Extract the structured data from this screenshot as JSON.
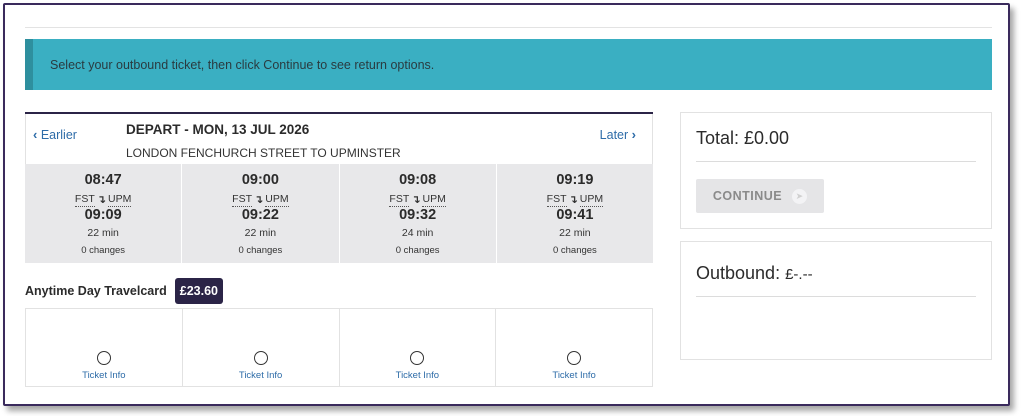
{
  "banner": {
    "text": "Select your outbound ticket, then click Continue to see return options."
  },
  "journey": {
    "earlier_label": "Earlier",
    "later_label": "Later",
    "depart_title": "DEPART - MON, 13 JUL 2026",
    "route": "LONDON FENCHURCH STREET TO UPMINSTER",
    "trains": [
      {
        "depart": "08:47",
        "from": "FST",
        "to": "UPM",
        "arrive": "09:09",
        "duration": "22 min",
        "changes": "0 changes"
      },
      {
        "depart": "09:00",
        "from": "FST",
        "to": "UPM",
        "arrive": "09:22",
        "duration": "22 min",
        "changes": "0 changes"
      },
      {
        "depart": "09:08",
        "from": "FST",
        "to": "UPM",
        "arrive": "09:32",
        "duration": "24 min",
        "changes": "0 changes"
      },
      {
        "depart": "09:19",
        "from": "FST",
        "to": "UPM",
        "arrive": "09:41",
        "duration": "22 min",
        "changes": "0 changes"
      }
    ]
  },
  "fare": {
    "name": "Anytime Day Travelcard",
    "price": "£23.60",
    "ticket_info_label": "Ticket Info"
  },
  "summary": {
    "total_label": "Total: £0.00",
    "continue_label": "CONTINUE",
    "outbound_label": "Outbound:",
    "outbound_value": "£-.--"
  },
  "icons": {
    "earlier": "chevron-left-icon",
    "later": "chevron-right-icon",
    "route_arrow": "curved-arrow-down-icon",
    "continue": "arrow-right-circle-icon"
  },
  "colors": {
    "banner": "#3aafc2",
    "accent_dark": "#2b2447",
    "link": "#2e6ca8"
  }
}
